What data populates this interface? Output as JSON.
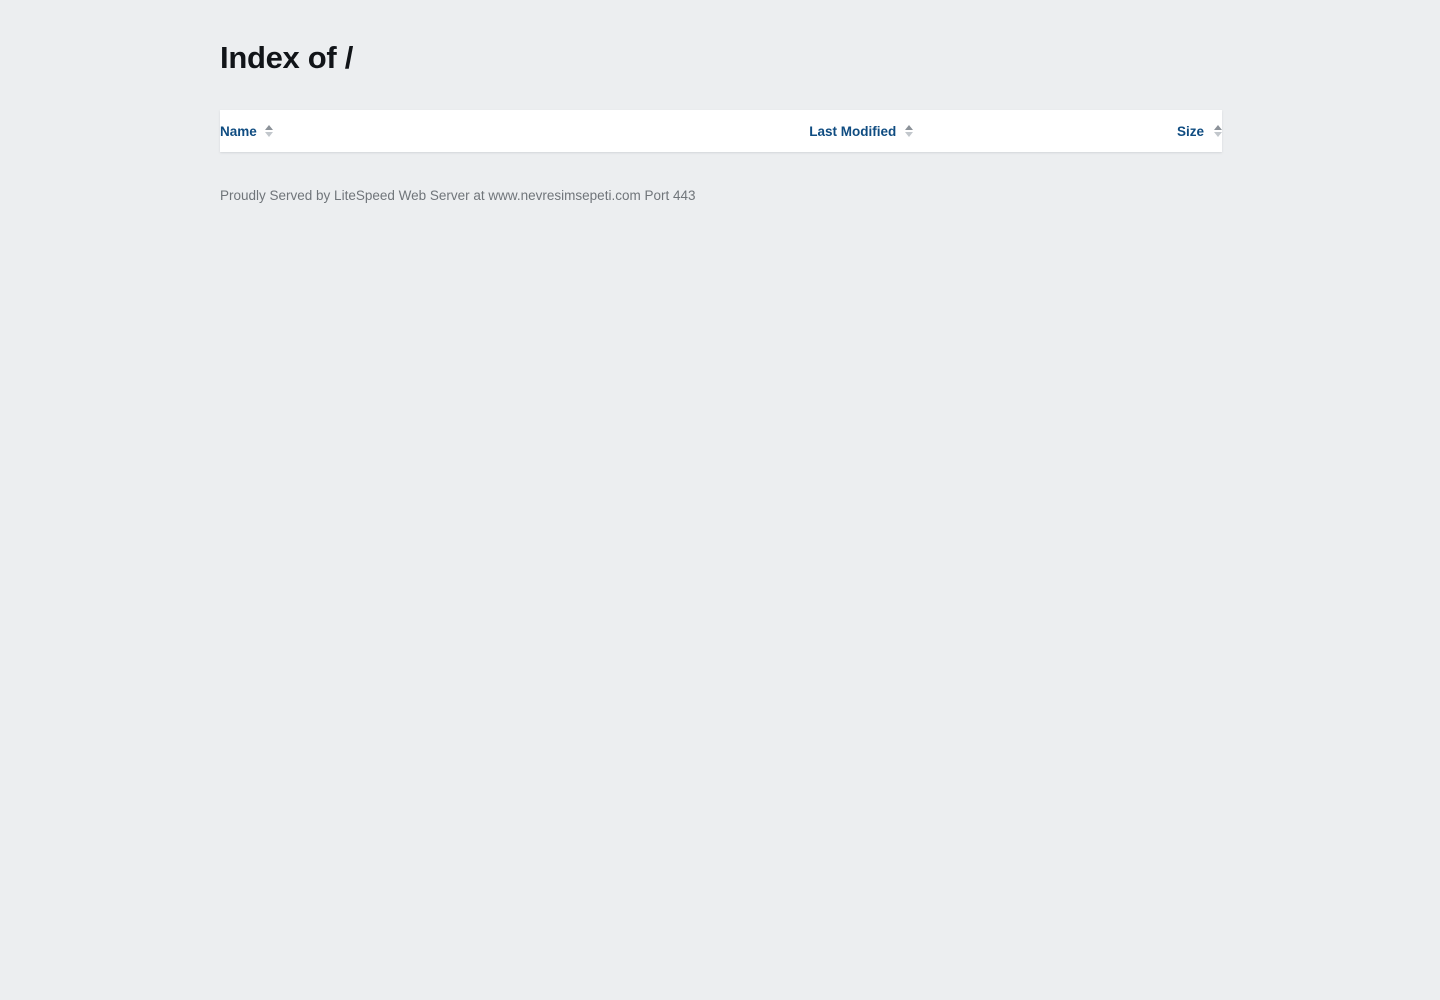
{
  "page": {
    "title": "Index of /",
    "background_color": "#eceef0"
  },
  "listing": {
    "columns": [
      {
        "label": "Name",
        "sort_icon": "sort-ascending-descending-icon",
        "align": "left"
      },
      {
        "label": "Last Modified",
        "sort_icon": "sort-ascending-descending-icon",
        "align": "center"
      },
      {
        "label": "Size",
        "sort_icon": "sort-ascending-descending-icon",
        "align": "right"
      }
    ],
    "rows": [],
    "header_link_color": "#0f4c81",
    "card_background": "#ffffff"
  },
  "footer": {
    "text": "Proudly Served by LiteSpeed Web Server at www.nevresimsepeti.com Port 443",
    "color": "#70757a"
  }
}
